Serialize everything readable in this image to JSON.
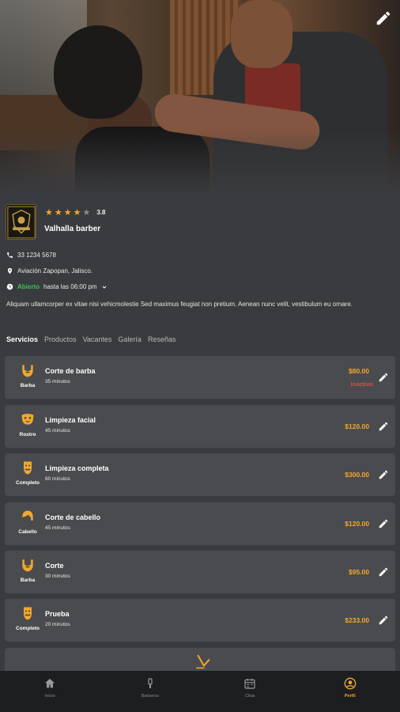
{
  "profile": {
    "name": "Valhalla barber",
    "rating": "3.8",
    "stars_filled": 4,
    "stars_total": 5,
    "phone": "33 1234 5678",
    "address": "Aviación Zapopan, Jalisco.",
    "open_status": "Abierto",
    "hours": "hasta las 06:00 pm",
    "description": "Aliquam ullamcorper ex vitae nisi vehicmolestie Sed maximus feugiat non pretium. Aenean nunc velit, vestibulum eu ornare."
  },
  "tabs": [
    "Servicios",
    "Productos",
    "Vacantes",
    "Galería",
    "Reseñas"
  ],
  "services": [
    {
      "category": "Barba",
      "icon": "beard-icon",
      "title": "Corte de barba",
      "duration": "35 minutos",
      "price": "$80.00",
      "status": "Inactivo"
    },
    {
      "category": "Rostro",
      "icon": "face-mask-icon",
      "title": "Limpieza facial",
      "duration": "45 minutos",
      "price": "$120.00",
      "status": ""
    },
    {
      "category": "Completo",
      "icon": "full-face-icon",
      "title": "Limpieza completa",
      "duration": "60 minutos",
      "price": "$300.00",
      "status": ""
    },
    {
      "category": "Cabello",
      "icon": "hair-icon",
      "title": "Corte de cabello",
      "duration": "45 minutos",
      "price": "$120.00",
      "status": ""
    },
    {
      "category": "Barba",
      "icon": "beard-icon",
      "title": "Corte",
      "duration": "30 minutos",
      "price": "$95.00",
      "status": ""
    },
    {
      "category": "Completo",
      "icon": "full-face-icon",
      "title": "Prueba",
      "duration": "20 minutos",
      "price": "$233.00",
      "status": ""
    }
  ],
  "nav": [
    {
      "label": "Inicio",
      "icon": "home-icon"
    },
    {
      "label": "Barberos",
      "icon": "razor-icon"
    },
    {
      "label": "Citas",
      "icon": "calendar-icon"
    },
    {
      "label": "Perfil",
      "icon": "profile-icon"
    }
  ],
  "colors": {
    "accent": "#f2a82c",
    "open": "#37c25a",
    "inactive": "#e5484d",
    "card": "#4a4b4e",
    "background": "#3a3b3e"
  }
}
